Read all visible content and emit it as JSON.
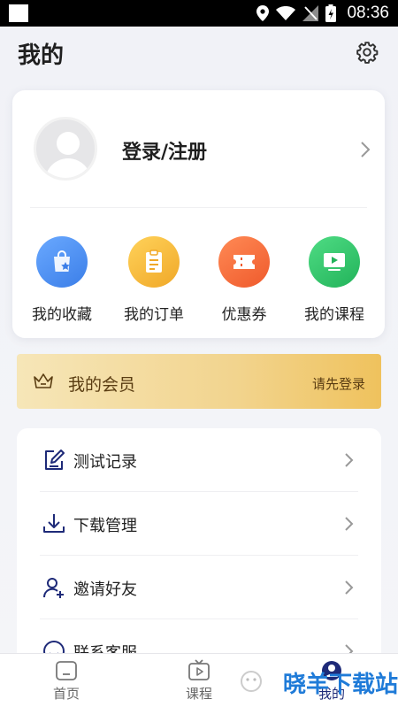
{
  "status_bar": {
    "time": "08:36"
  },
  "header": {
    "title": "我的"
  },
  "profile": {
    "login_label": "登录/注册"
  },
  "quick_actions": [
    {
      "label": "我的收藏",
      "icon": "favorites-bag-icon",
      "color": "#4a8ef0"
    },
    {
      "label": "我的订单",
      "icon": "order-clipboard-icon",
      "color": "#f0b030"
    },
    {
      "label": "优惠券",
      "icon": "coupon-ticket-icon",
      "color": "#f46a3c"
    },
    {
      "label": "我的课程",
      "icon": "course-video-icon",
      "color": "#2cc064"
    }
  ],
  "vip": {
    "title": "我的会员",
    "cta": "请先登录"
  },
  "menu": [
    {
      "label": "测试记录",
      "icon": "edit-record-icon"
    },
    {
      "label": "下载管理",
      "icon": "download-icon"
    },
    {
      "label": "邀请好友",
      "icon": "invite-user-icon"
    },
    {
      "label": "联系客服",
      "icon": "customer-service-icon"
    }
  ],
  "tabs": [
    {
      "label": "首页",
      "icon": "home-icon"
    },
    {
      "label": "课程",
      "icon": "course-tv-icon"
    },
    {
      "label": "我的",
      "icon": "profile-icon"
    }
  ],
  "watermark": {
    "text": "晓羊下载站"
  },
  "colors": {
    "accent": "#1e2a78",
    "vip_gold": "#efc25d",
    "background": "#f3f4f8"
  }
}
